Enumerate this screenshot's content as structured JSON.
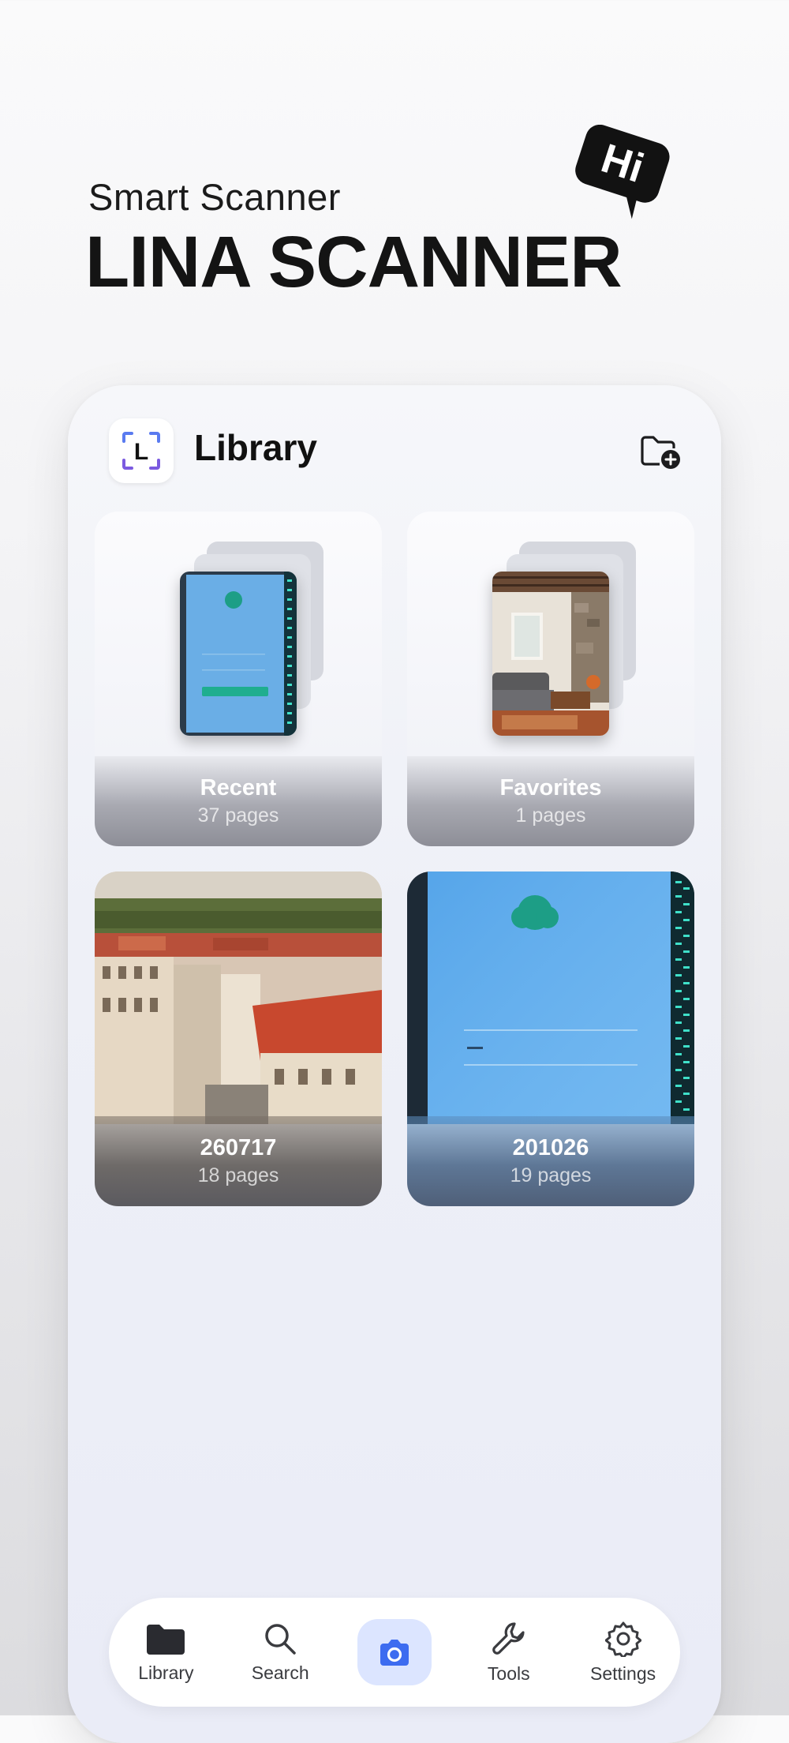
{
  "hero": {
    "subtitle": "Smart Scanner",
    "title": "LINA SCANNER",
    "bubble_text": "Hi"
  },
  "header": {
    "title": "Library",
    "logo_letter": "L"
  },
  "albums": [
    {
      "name": "Recent",
      "count": "37 pages"
    },
    {
      "name": "Favorites",
      "count": "1 pages"
    },
    {
      "name": "260717",
      "count": "18 pages"
    },
    {
      "name": "201026",
      "count": "19 pages"
    }
  ],
  "nav": {
    "items": [
      {
        "label": "Library",
        "icon": "folder-icon"
      },
      {
        "label": "Search",
        "icon": "search-icon"
      },
      {
        "label": "",
        "icon": "camera-icon"
      },
      {
        "label": "Tools",
        "icon": "wrench-icon"
      },
      {
        "label": "Settings",
        "icon": "gear-icon"
      }
    ]
  },
  "colors": {
    "accent": "#3d6cf0",
    "accent_soft": "#dce5ff",
    "text_dark": "#111111"
  }
}
